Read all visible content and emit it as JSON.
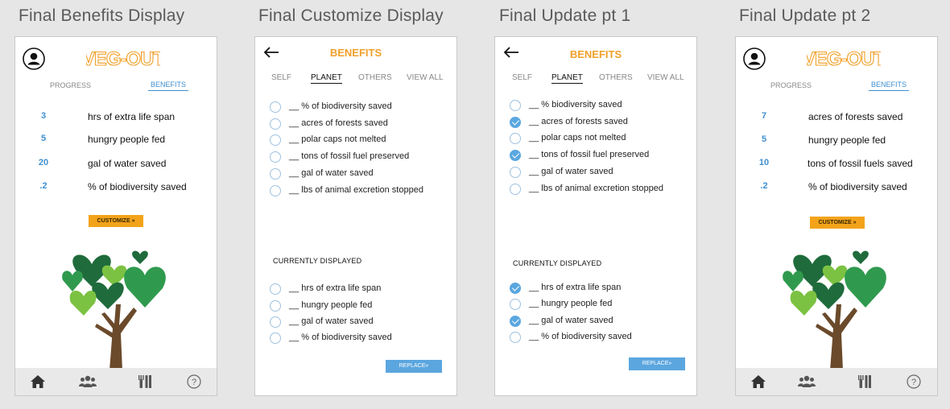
{
  "boards": [
    {
      "title": "Final Benefits Display",
      "logo_text": "VEG-OUT",
      "tabs": {
        "progress": "PROGRESS",
        "benefits": "BENEFITS"
      },
      "stats": [
        {
          "value": "3",
          "label": "hrs of extra life span"
        },
        {
          "value": "5",
          "label": "hungry people fed"
        },
        {
          "value": "20",
          "label": "gal of water saved"
        },
        {
          "value": ".2",
          "label": "% of biodiversity saved"
        }
      ],
      "customize_label": "CUSTOMIZE »",
      "nav_icons": [
        "home-icon",
        "people-icon",
        "utensils-icon",
        "help-icon"
      ]
    },
    {
      "title": "Final Customize Display",
      "header_title": "BENEFITS",
      "tabs": [
        "SELF",
        "PLANET",
        "OTHERS",
        "VIEW ALL"
      ],
      "options": [
        {
          "label": "__ % of biodiversity saved",
          "checked": false
        },
        {
          "label": "__ acres of forests saved",
          "checked": false
        },
        {
          "label": "__ polar caps not melted",
          "checked": false
        },
        {
          "label": "__ tons of fossil fuel preserved",
          "checked": false
        },
        {
          "label": "__ gal of water saved",
          "checked": false
        },
        {
          "label": "__ lbs of animal excretion stopped",
          "checked": false
        }
      ],
      "currently_heading": "CURRENTLY DISPLAYED",
      "current": [
        {
          "label": "__ hrs of extra life span",
          "checked": false
        },
        {
          "label": "__ hungry people fed",
          "checked": false
        },
        {
          "label": "__ gal of water saved",
          "checked": false
        },
        {
          "label": "__ % of biodiversity saved",
          "checked": false
        }
      ],
      "replace_label": "REPLACE»"
    },
    {
      "title": "Final Update pt 1",
      "header_title": "BENEFITS",
      "tabs": [
        "SELF",
        "PLANET",
        "OTHERS",
        "VIEW ALL"
      ],
      "options": [
        {
          "label": "__ % biodiversity saved",
          "checked": false
        },
        {
          "label": "__ acres of forests saved",
          "checked": true
        },
        {
          "label": "__ polar caps not melted",
          "checked": false
        },
        {
          "label": "__ tons of fossil fuel preserved",
          "checked": true
        },
        {
          "label": "__ gal of water saved",
          "checked": false
        },
        {
          "label": "__ lbs of animal excretion stopped",
          "checked": false
        }
      ],
      "currently_heading": "CURRENTLY DISPLAYED",
      "current": [
        {
          "label": "__ hrs of extra life span",
          "checked": true
        },
        {
          "label": "__ hungry people fed",
          "checked": false
        },
        {
          "label": "__ gal of water saved",
          "checked": true
        },
        {
          "label": "__ % of biodiversity saved",
          "checked": false
        }
      ],
      "replace_label": "REPLACE»"
    },
    {
      "title": "Final Update pt 2",
      "logo_text": "VEG-OUT",
      "tabs": {
        "progress": "PROGRESS",
        "benefits": "BENEFITS"
      },
      "stats": [
        {
          "value": "7",
          "label": "acres of forests saved"
        },
        {
          "value": "5",
          "label": "hungry people fed"
        },
        {
          "value": "10",
          "label": "tons of fossil fuels saved"
        },
        {
          "value": ".2",
          "label": "% of biodiversity saved"
        }
      ],
      "customize_label": "CUSTOMIZE »",
      "nav_icons": [
        "home-icon",
        "people-icon",
        "utensils-icon",
        "help-icon"
      ]
    }
  ],
  "colors": {
    "accent_blue": "#3e8fd1",
    "accent_orange": "#f0a02a",
    "button_orange": "#f2a31a",
    "replace_blue": "#5ba6df",
    "tree_dark": "#1f6b3c",
    "tree_mid": "#2f9a4e",
    "tree_light": "#7cc242",
    "trunk": "#6b4a2b"
  }
}
